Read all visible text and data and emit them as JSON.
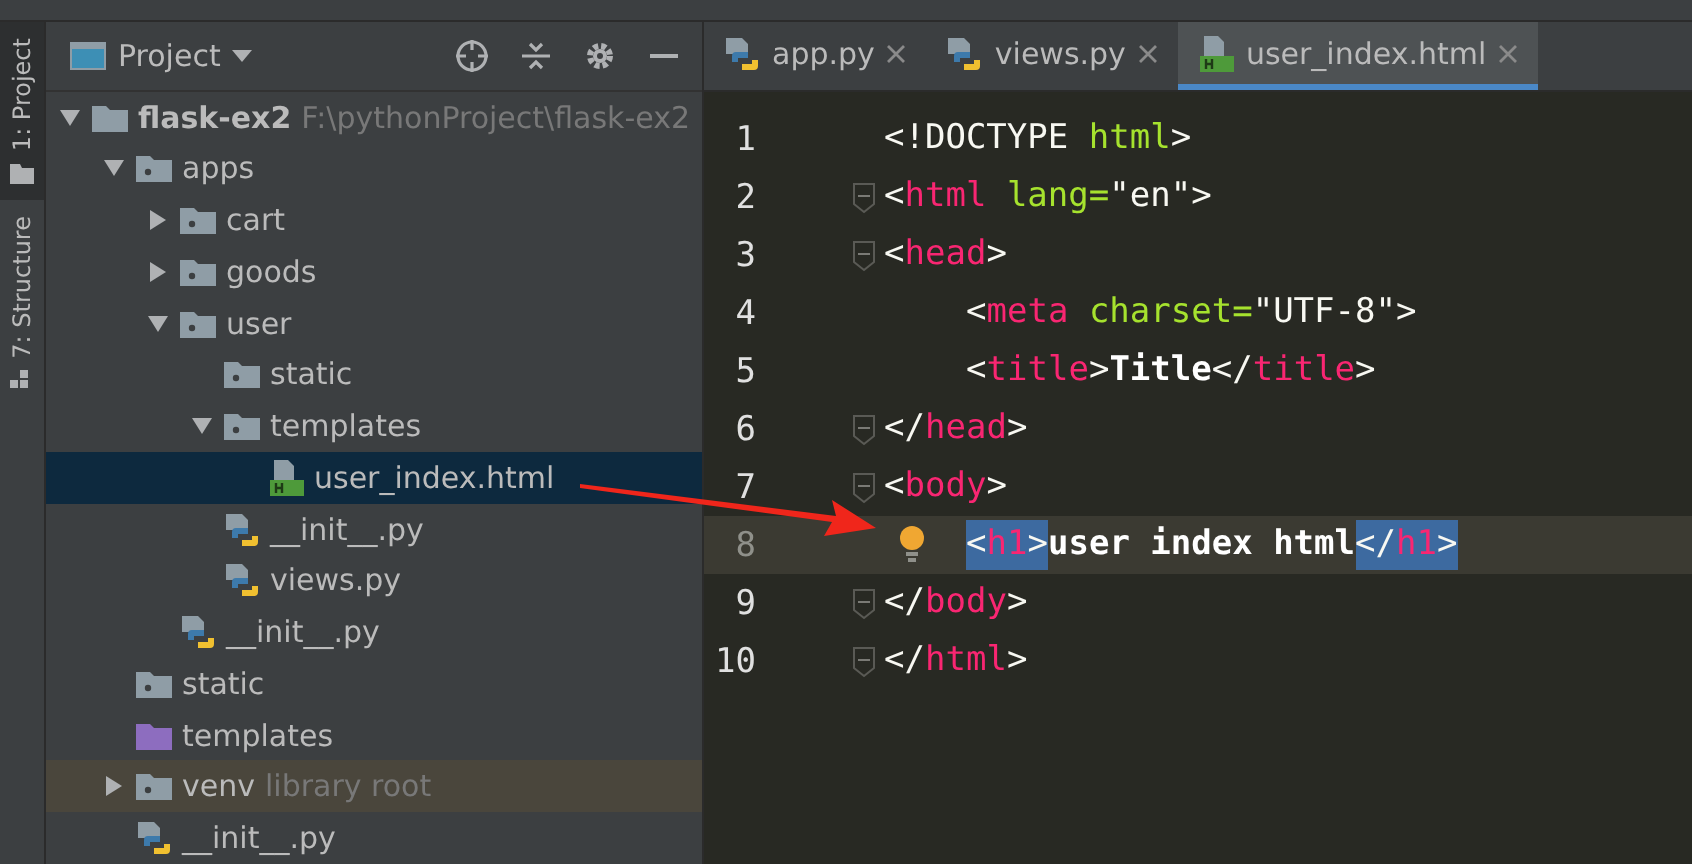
{
  "tool_strip": [
    {
      "label": "1: Project",
      "selected": true
    },
    {
      "label": "7: Structure",
      "selected": false
    }
  ],
  "project_panel": {
    "title": "Project"
  },
  "tree": [
    {
      "name": "flask-ex2",
      "hint": "F:\\pythonProject\\flask-ex2",
      "kind": "root",
      "expanded": true,
      "selected": false,
      "children": [
        {
          "name": "apps",
          "kind": "module",
          "expanded": true,
          "selected": false,
          "children": [
            {
              "name": "cart",
              "kind": "module",
              "expanded": false,
              "selected": false
            },
            {
              "name": "goods",
              "kind": "module",
              "expanded": false,
              "selected": false
            },
            {
              "name": "user",
              "kind": "module",
              "expanded": true,
              "selected": false,
              "children": [
                {
                  "name": "static",
                  "kind": "module",
                  "selected": false
                },
                {
                  "name": "templates",
                  "kind": "module",
                  "expanded": true,
                  "selected": false,
                  "children": [
                    {
                      "name": "user_index.html",
                      "kind": "html",
                      "selected": true
                    }
                  ]
                },
                {
                  "name": "__init__.py",
                  "kind": "python",
                  "selected": false
                },
                {
                  "name": "views.py",
                  "kind": "python",
                  "selected": false
                }
              ]
            },
            {
              "name": "__init__.py",
              "kind": "python",
              "selected": false
            }
          ]
        },
        {
          "name": "static",
          "kind": "module",
          "selected": false
        },
        {
          "name": "templates",
          "kind": "templates",
          "selected": false
        },
        {
          "name": "venv",
          "hint": "library root",
          "kind": "module",
          "expanded": false,
          "selected": false,
          "library": true
        },
        {
          "name": "__init__.py",
          "kind": "python",
          "selected": false
        }
      ]
    }
  ],
  "tabs": [
    {
      "label": "app.py",
      "kind": "python",
      "selected": false
    },
    {
      "label": "views.py",
      "kind": "python",
      "selected": false
    },
    {
      "label": "user_index.html",
      "kind": "html",
      "selected": true
    }
  ],
  "lines": [
    {
      "number": "1",
      "fold": false,
      "indent": false,
      "current": false,
      "tokens": [
        {
          "kind": "punct",
          "text": "<!DOCTYPE "
        },
        {
          "kind": "attr",
          "text": "html"
        },
        {
          "kind": "punct",
          "text": ">"
        }
      ]
    },
    {
      "number": "2",
      "fold": true,
      "indent": false,
      "current": false,
      "tokens": [
        {
          "kind": "punct",
          "text": "<"
        },
        {
          "kind": "tag",
          "text": "html "
        },
        {
          "kind": "attr",
          "text": "lang="
        },
        {
          "kind": "string",
          "text": "\"en\""
        },
        {
          "kind": "punct",
          "text": ">"
        }
      ]
    },
    {
      "number": "3",
      "fold": true,
      "indent": false,
      "current": false,
      "tokens": [
        {
          "kind": "punct",
          "text": "<"
        },
        {
          "kind": "tag",
          "text": "head"
        },
        {
          "kind": "punct",
          "text": ">"
        }
      ]
    },
    {
      "number": "4",
      "fold": false,
      "indent": true,
      "current": false,
      "tokens": [
        {
          "kind": "punct",
          "text": "<"
        },
        {
          "kind": "tag",
          "text": "meta "
        },
        {
          "kind": "attr",
          "text": "charset="
        },
        {
          "kind": "string",
          "text": "\"UTF-8\""
        },
        {
          "kind": "punct",
          "text": ">"
        }
      ]
    },
    {
      "number": "5",
      "fold": false,
      "indent": true,
      "current": false,
      "tokens": [
        {
          "kind": "punct",
          "text": "<"
        },
        {
          "kind": "tag",
          "text": "title"
        },
        {
          "kind": "punct",
          "text": ">"
        },
        {
          "kind": "text",
          "text": "Title"
        },
        {
          "kind": "punct",
          "text": "</"
        },
        {
          "kind": "tag",
          "text": "title"
        },
        {
          "kind": "punct",
          "text": ">"
        }
      ]
    },
    {
      "number": "6",
      "fold": true,
      "indent": false,
      "current": false,
      "tokens": [
        {
          "kind": "punct",
          "text": "</"
        },
        {
          "kind": "tag",
          "text": "head"
        },
        {
          "kind": "punct",
          "text": ">"
        }
      ]
    },
    {
      "number": "7",
      "fold": true,
      "indent": false,
      "current": false,
      "tokens": [
        {
          "kind": "punct",
          "text": "<"
        },
        {
          "kind": "tag",
          "text": "body"
        },
        {
          "kind": "punct",
          "text": ">"
        }
      ]
    },
    {
      "number": "8",
      "fold": false,
      "indent": true,
      "current": true,
      "bulb": true,
      "tokens": [
        {
          "kind": "punct",
          "text": "<",
          "highlighted": true
        },
        {
          "kind": "tag",
          "text": "h1",
          "highlighted": true
        },
        {
          "kind": "punct",
          "text": ">",
          "highlighted": true
        },
        {
          "kind": "text",
          "text": "user index html",
          "highlighted": false
        },
        {
          "kind": "punct",
          "text": "</",
          "highlighted": true
        },
        {
          "kind": "tag",
          "text": "h1",
          "highlighted": true
        },
        {
          "kind": "punct",
          "text": ">",
          "highlighted": true
        }
      ]
    },
    {
      "number": "9",
      "fold": true,
      "indent": false,
      "current": false,
      "tokens": [
        {
          "kind": "punct",
          "text": "</"
        },
        {
          "kind": "tag",
          "text": "body"
        },
        {
          "kind": "punct",
          "text": ">"
        }
      ]
    },
    {
      "number": "10",
      "fold": true,
      "indent": false,
      "current": false,
      "tokens": [
        {
          "kind": "punct",
          "text": "</"
        },
        {
          "kind": "tag",
          "text": "html"
        },
        {
          "kind": "punct",
          "text": ">"
        }
      ]
    }
  ]
}
